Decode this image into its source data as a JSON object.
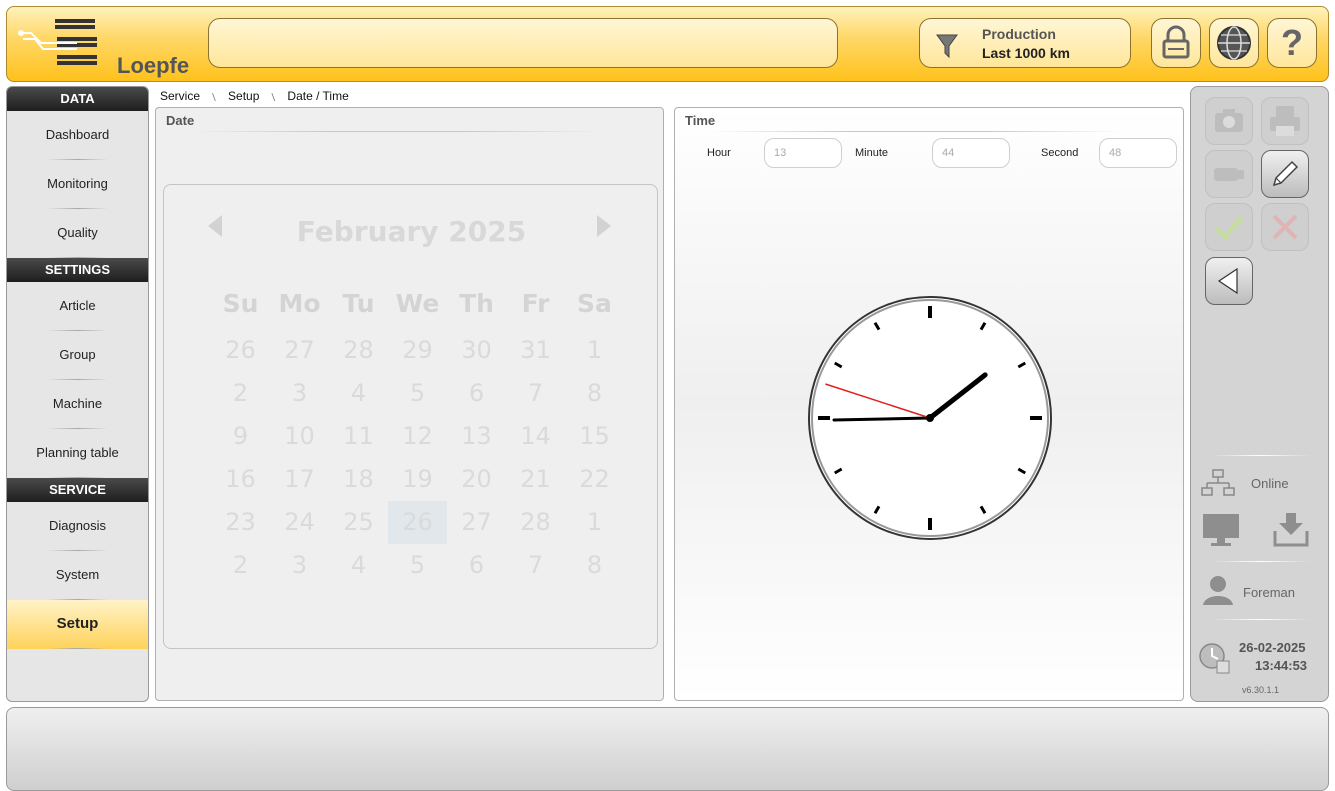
{
  "app": {
    "logo_text": "Loepfe"
  },
  "header": {
    "search_value": "",
    "filter": {
      "title": "Production",
      "subtitle": "Last 1000 km"
    },
    "buttons": [
      {
        "icon": "lock-icon"
      },
      {
        "icon": "globe-icon"
      },
      {
        "icon": "help-icon",
        "label": "?"
      }
    ]
  },
  "sidebar": {
    "sections": [
      {
        "title": "DATA",
        "items": [
          "Dashboard",
          "Monitoring",
          "Quality"
        ]
      },
      {
        "title": "SETTINGS",
        "items": [
          "Article",
          "Group",
          "Machine",
          "Planning table"
        ]
      },
      {
        "title": "SERVICE",
        "items": [
          "Diagnosis",
          "System",
          "Setup"
        ]
      }
    ],
    "active": "Setup"
  },
  "breadcrumb": [
    "Service",
    "Setup",
    "Date / Time"
  ],
  "date_panel": {
    "title": "Date",
    "calendar": {
      "month_label": "February 2025",
      "weekdays": [
        "Su",
        "Mo",
        "Tu",
        "We",
        "Th",
        "Fr",
        "Sa"
      ],
      "weeks": [
        [
          "26",
          "27",
          "28",
          "29",
          "30",
          "31",
          "1"
        ],
        [
          "2",
          "3",
          "4",
          "5",
          "6",
          "7",
          "8"
        ],
        [
          "9",
          "10",
          "11",
          "12",
          "13",
          "14",
          "15"
        ],
        [
          "16",
          "17",
          "18",
          "19",
          "20",
          "21",
          "22"
        ],
        [
          "23",
          "24",
          "25",
          "26",
          "27",
          "28",
          "1"
        ],
        [
          "2",
          "3",
          "4",
          "5",
          "6",
          "7",
          "8"
        ]
      ],
      "selected": {
        "week": 4,
        "day": 3
      }
    }
  },
  "time_panel": {
    "title": "Time",
    "hour_label": "Hour",
    "hour_value": "13",
    "minute_label": "Minute",
    "minute_value": "44",
    "second_label": "Second",
    "second_value": "48",
    "clock": {
      "hour": 13,
      "minute": 44,
      "second": 48,
      "second_hand_color": "#e02020"
    }
  },
  "right_panel": {
    "buttons": [
      "camera-icon",
      "print-icon",
      "usb-icon",
      "edit-icon",
      "accept-icon",
      "cancel-icon",
      "back-icon"
    ],
    "status_label": "Online",
    "user_label": "Foreman",
    "date": "26-02-2025",
    "time": "13:44:53",
    "version": "v6.30.1.1"
  },
  "colors": {
    "accent": "#ffc21c",
    "nav_active": "#ffd25a",
    "nav_header": "#2a2a2a"
  }
}
